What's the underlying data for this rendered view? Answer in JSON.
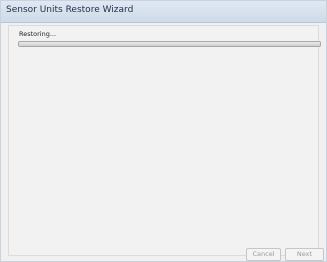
{
  "window": {
    "title": "Sensor Units Restore Wizard"
  },
  "progress": {
    "status_text": "Restoring...",
    "value": 1.0
  },
  "buttons": {
    "cancel_label": "Cancel",
    "next_label": "Next"
  }
}
